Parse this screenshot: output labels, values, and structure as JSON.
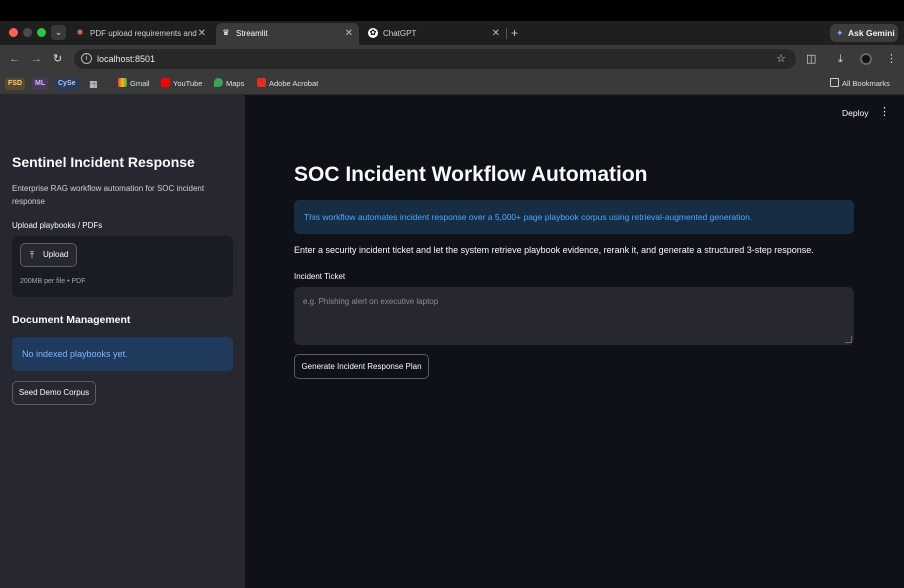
{
  "browser": {
    "tabs": [
      {
        "title": "PDF upload requirements and",
        "active": false
      },
      {
        "title": "Streamlit",
        "active": true
      },
      {
        "title": "ChatGPT",
        "active": false
      }
    ],
    "new_tab": "+",
    "ask_gemini": "Ask Gemini",
    "url": "localhost:8501",
    "bookmarks": [
      {
        "label": "FSD"
      },
      {
        "label": "ML"
      },
      {
        "label": "CySe"
      },
      {
        "label": "Gmail"
      },
      {
        "label": "YouTube"
      },
      {
        "label": "Maps"
      },
      {
        "label": "Adobe Acrobat"
      }
    ],
    "all_bookmarks": "All Bookmarks"
  },
  "sidebar": {
    "title": "Sentinel Incident Response",
    "description": "Enterprise RAG workflow automation for SOC incident response",
    "upload_label": "Upload playbooks / PDFs",
    "upload_button": "Upload",
    "upload_hint": "200MB per file • PDF",
    "doc_mgmt_title": "Document Management",
    "no_playbooks": "No indexed playbooks yet.",
    "seed_button": "Seed Demo Corpus"
  },
  "header": {
    "deploy": "Deploy"
  },
  "main": {
    "title": "SOC Incident Workflow Automation",
    "info": "This workflow automates incident response over a 5,000+ page playbook corpus using retrieval-augmented generation.",
    "description": "Enter a security incident ticket and let the system retrieve playbook evidence, rerank it, and generate a structured 3-step response.",
    "ticket_label": "Incident Ticket",
    "ticket_placeholder": "e.g. Phishing alert on executive laptop",
    "ticket_value": "",
    "generate_button": "Generate Incident Response Plan"
  }
}
